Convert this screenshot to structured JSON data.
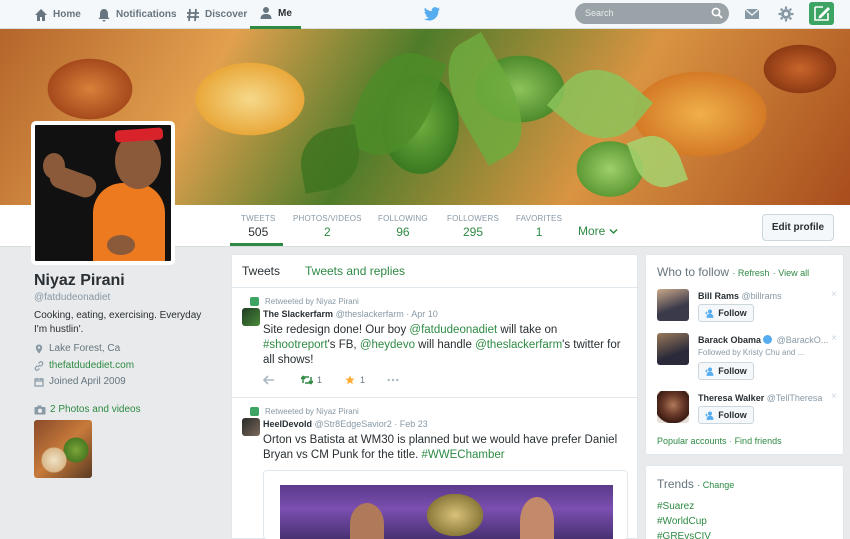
{
  "nav": {
    "home": "Home",
    "notifications": "Notifications",
    "discover": "Discover",
    "me": "Me",
    "search_placeholder": "Search"
  },
  "profile": {
    "name": "Niyaz Pirani",
    "handle": "@fatdudeonadiet",
    "bio": "Cooking, eating, exercising. Everyday I'm hustlin'.",
    "location": "Lake Forest, Ca",
    "website": "thefatdudediet.com",
    "joined": "Joined April 2009",
    "photos_label": "2 Photos and videos"
  },
  "stats": [
    {
      "label": "TWEETS",
      "value": "505"
    },
    {
      "label": "PHOTOS/VIDEOS",
      "value": "2"
    },
    {
      "label": "FOLLOWING",
      "value": "96"
    },
    {
      "label": "FOLLOWERS",
      "value": "295"
    },
    {
      "label": "FAVORITES",
      "value": "1"
    }
  ],
  "more_label": "More",
  "edit_profile_label": "Edit profile",
  "timeline": {
    "tabs": [
      "Tweets",
      "Tweets and replies"
    ],
    "tweets": [
      {
        "retweeted_by": "Retweeted by Niyaz Pirani",
        "name": "The Slackerfarm",
        "handle": "@theslackerfarm",
        "date": "Apr 10",
        "text_parts": [
          "Site redesign done! Our boy ",
          "@fatdudeonadiet",
          " will take on ",
          "#shootreport",
          "'s FB, ",
          "@heydevo",
          " will handle ",
          "@theslackerfarm",
          "'s twitter for all shows!"
        ],
        "retweets": "1",
        "favorites": "1"
      },
      {
        "retweeted_by": "Retweeted by Niyaz Pirani",
        "name": "HeelDevold",
        "handle": "@Str8EdgeSavior2",
        "date": "Feb 23",
        "text_parts": [
          "Orton vs Batista at WM30 is planned but we would have prefer Daniel Bryan vs CM Punk for the title. ",
          "#WWEChamber"
        ]
      }
    ]
  },
  "who_to_follow": {
    "title": "Who to follow",
    "refresh": "Refresh",
    "view_all": "View all",
    "follow_label": "Follow",
    "suggestions": [
      {
        "name": "Bill Rams",
        "handle": "@billrams",
        "extra": ""
      },
      {
        "name": "Barack Obama",
        "handle": "@BarackO...",
        "extra": "Followed by Kristy Chu and ..."
      },
      {
        "name": "Theresa Walker",
        "handle": "@TellTheresa",
        "extra": ""
      }
    ],
    "popular_accounts": "Popular accounts",
    "find_friends": "Find friends"
  },
  "trends": {
    "title": "Trends",
    "change": "Change",
    "items": [
      "#Suarez",
      "#WorldCup",
      "#GREvsCIV"
    ]
  },
  "colors": {
    "accent": "#2e8a43",
    "compose": "#3ea463",
    "topbar": "#f5f8fa"
  }
}
